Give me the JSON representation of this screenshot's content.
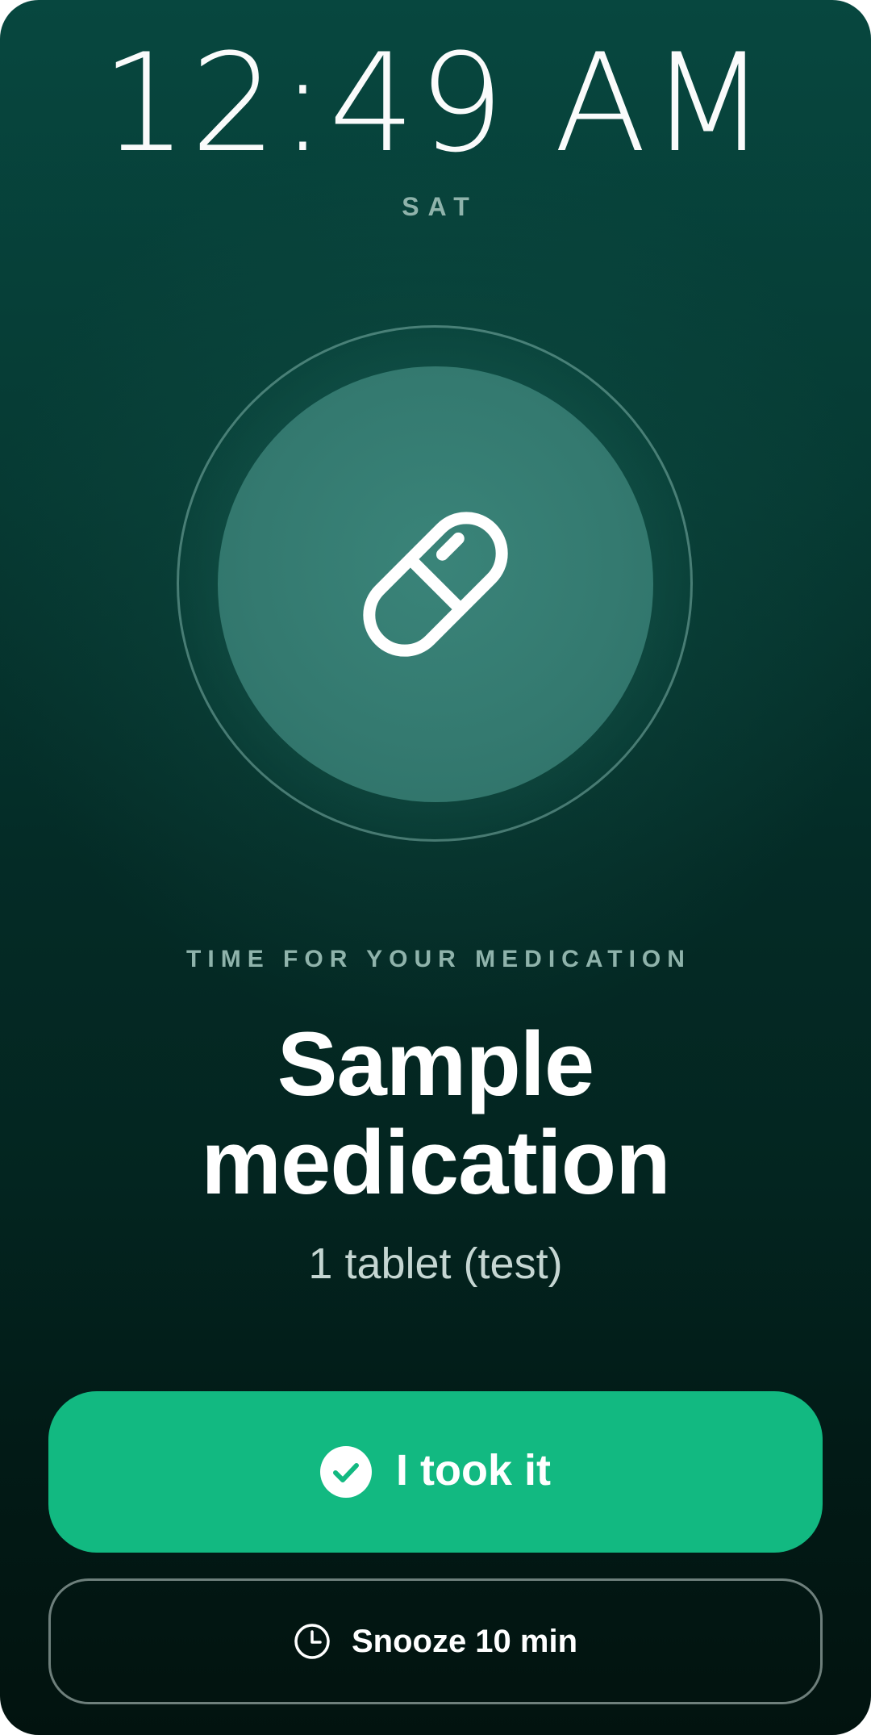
{
  "status": {
    "time": "12:49 AM",
    "day": "SAT"
  },
  "alarm": {
    "icon": "pill-icon",
    "subtitle": "TIME FOR YOUR MEDICATION",
    "medication_name": "Sample medication",
    "dose": "1 tablet (test)"
  },
  "actions": {
    "took_label": "I took it",
    "took_icon": "check-circle-icon",
    "snooze_label": "Snooze 10 min",
    "snooze_icon": "clock-icon"
  },
  "colors": {
    "accent": "#12b981",
    "background_top": "#07473f",
    "background_bottom": "#02130f",
    "muted_text": "#8fb3ab"
  }
}
